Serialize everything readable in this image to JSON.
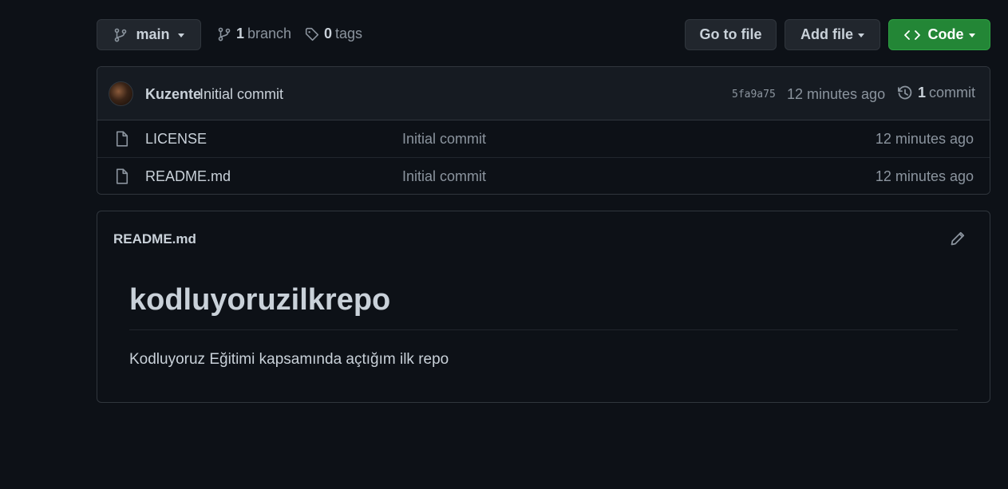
{
  "toolbar": {
    "branch_select": "main",
    "branch_count": "1",
    "branch_label": "branch",
    "tag_count": "0",
    "tag_label": "tags",
    "go_to_file": "Go to file",
    "add_file": "Add file",
    "code": "Code"
  },
  "latest_commit": {
    "author": "Kuzente",
    "message": "Initial commit",
    "sha": "5fa9a75",
    "time": "12 minutes ago",
    "count": "1",
    "count_label": "commit"
  },
  "files": [
    {
      "name": "LICENSE",
      "message": "Initial commit",
      "time": "12 minutes ago"
    },
    {
      "name": "README.md",
      "message": "Initial commit",
      "time": "12 minutes ago"
    }
  ],
  "readme": {
    "filename": "README.md",
    "heading": "kodluyoruzilkrepo",
    "body": "Kodluyoruz Eğitimi kapsamında açtığım ilk repo"
  },
  "colors": {
    "background": "#0d1117",
    "panel": "#161b22",
    "border": "#30363d",
    "accent_green": "#238636",
    "text": "#c9d1d9",
    "muted": "#8b949e"
  }
}
